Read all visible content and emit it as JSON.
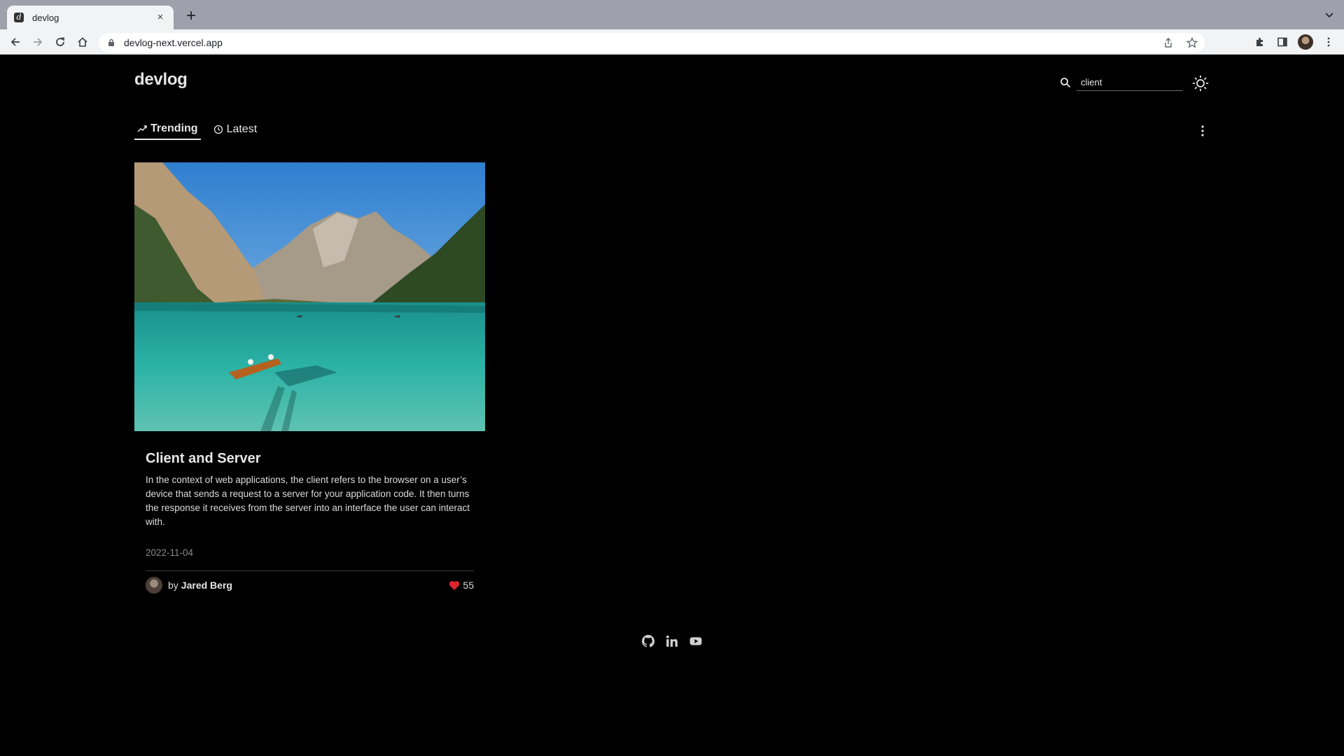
{
  "browser": {
    "tab_title": "devlog",
    "tab_close": "×",
    "new_tab": "+",
    "url": "devlog-next.vercel.app"
  },
  "header": {
    "logo": "devlog",
    "search_value": "client"
  },
  "tabs": [
    {
      "label": "Trending",
      "active": true
    },
    {
      "label": "Latest",
      "active": false
    }
  ],
  "post": {
    "title": "Client and Server",
    "description": "In the context of web applications, the client refers to the browser on a user’s device that sends a request to a server for your application code. It then turns the response it receives from the server into an interface the user can interact with.",
    "date": "2022-11-04",
    "author_prefix": "by",
    "author": "Jared Berg",
    "likes": "55"
  },
  "footer": {
    "icons": [
      "github-icon",
      "linkedin-icon",
      "youtube-icon"
    ]
  },
  "colors": {
    "background": "#000000",
    "text": "#e6e6e6",
    "muted": "#8a8a8a",
    "chrome_tabbar": "#9ea1ab",
    "chrome_toolbar": "#f1f3f4"
  }
}
